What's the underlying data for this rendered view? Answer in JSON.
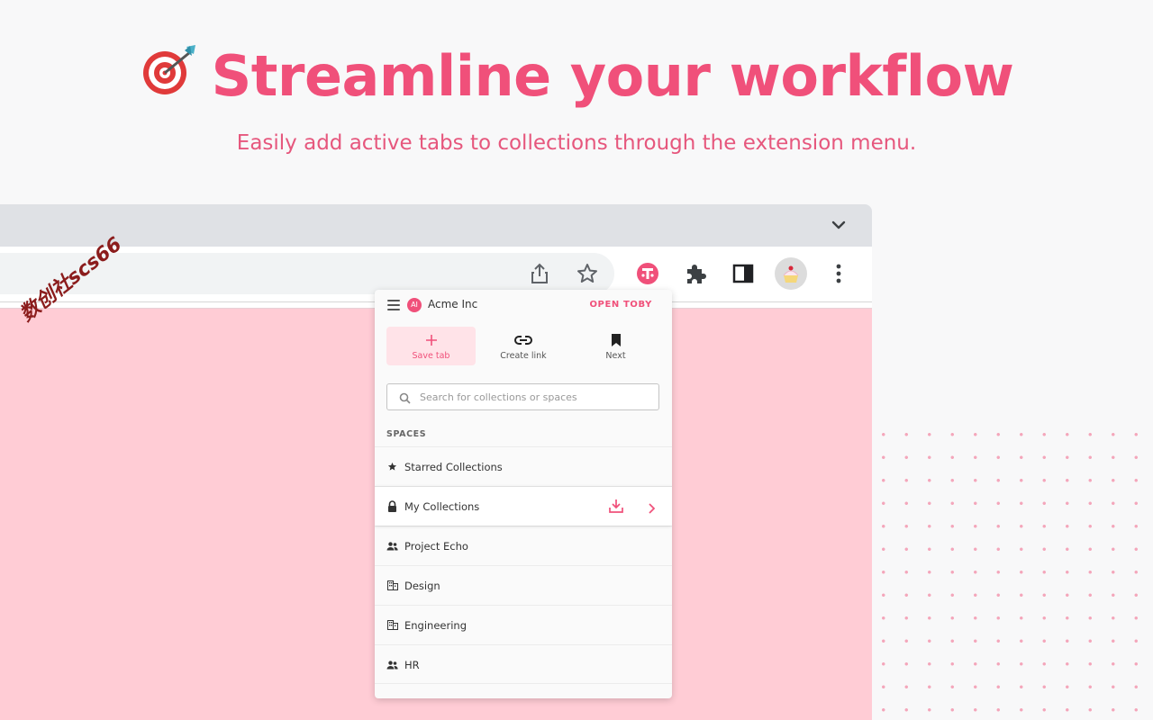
{
  "hero": {
    "title": "Streamline your workflow",
    "subtitle": "Easily add active tabs to collections through the extension menu.",
    "icon": "target-dart-icon"
  },
  "colors": {
    "accent": "#f0507a",
    "page_bg": "#ffccd5",
    "toolbar_bg": "#ffffff",
    "tabstrip_bg": "#dfe1e5"
  },
  "browser": {
    "icons": [
      "chevron-down-icon",
      "share-icon",
      "star-icon",
      "toby-extension-icon",
      "puzzle-icon",
      "side-panel-icon",
      "profile-avatar",
      "more-vert-icon"
    ]
  },
  "popup": {
    "org_badge": "AI",
    "org_name": "Acme Inc",
    "open_label": "OPEN TOBY",
    "actions": [
      {
        "label": "Save tab",
        "icon": "plus-icon"
      },
      {
        "label": "Create link",
        "icon": "link-icon"
      },
      {
        "label": "Next",
        "icon": "bookmark-icon"
      }
    ],
    "search_placeholder": "Search for collections or spaces",
    "spaces_label": "SPACES",
    "items": [
      {
        "label": "Starred Collections",
        "icon": "star-icon"
      },
      {
        "label": "My Collections",
        "icon": "lock-icon"
      },
      {
        "label": "Project Echo",
        "icon": "people-icon"
      },
      {
        "label": "Design",
        "icon": "building-icon"
      },
      {
        "label": "Engineering",
        "icon": "building-icon"
      },
      {
        "label": "HR",
        "icon": "people-icon"
      }
    ]
  },
  "watermark": "数创社scs66"
}
